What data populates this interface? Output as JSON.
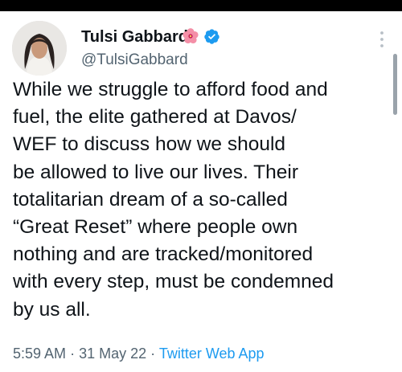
{
  "author": {
    "display_name": "Tulsi Gabbard",
    "handle": "@TulsiGabbard",
    "badge_icon": "hibiscus-flower-icon",
    "verified_icon": "verified-badge-icon",
    "verified_color": "#1d9bf0"
  },
  "tweet": {
    "lines": [
      "While we struggle to afford food and",
      "fuel, the elite gathered at Davos/",
      "WEF to discuss how we should",
      "be allowed to live our lives. Their",
      "totalitarian dream of a so-called",
      "“Great Reset” where people own",
      "nothing and are tracked/monitored",
      "with every step, must be condemned",
      "by us all."
    ]
  },
  "meta": {
    "time": "5:59 AM",
    "separator": "·",
    "date": "31 May 22",
    "source": "Twitter Web App"
  },
  "colors": {
    "text": "#0f1419",
    "secondary": "#536471",
    "link": "#1d9bf0"
  }
}
